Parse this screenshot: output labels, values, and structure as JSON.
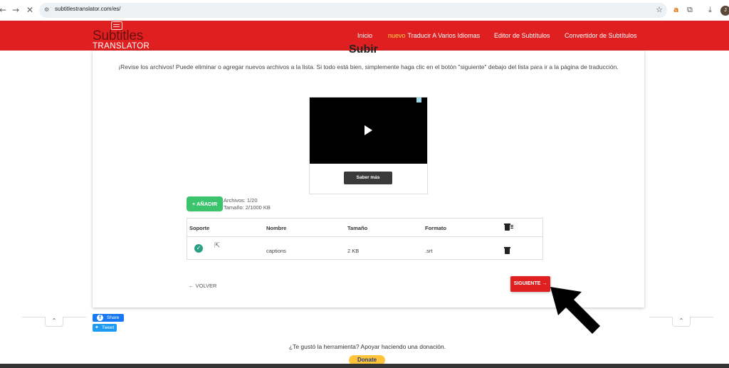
{
  "browser": {
    "url": "subtitlestranslator.com/es/",
    "profile_initial": "J"
  },
  "header": {
    "logo_main": "Subtitles",
    "logo_sub": "TRANSLATOR",
    "nav": [
      {
        "label": "Inicio"
      },
      {
        "badge": "nuevo",
        "label": "Traducir A Varios Idiomas"
      },
      {
        "label": "Editor de Subtítulos"
      },
      {
        "label": "Convertidor de Subtítulos"
      }
    ],
    "colors": {
      "brand": "#e02020",
      "new_badge": "#ffd54f"
    }
  },
  "main": {
    "title": "Subir",
    "intro": "¡Revise los archivos! Puede eliminar o agregar nuevos archivos a la lista. Si todo está bien, simplemente haga clic en el botón \"siguiente\" debajo del lista para ir a la página de traducción.",
    "ad": {
      "button_label": "Saber más"
    },
    "add_button": "+ AÑADIR",
    "files_count": "Archivos: 1/20",
    "size_info": "Tamaño: 2/1000 KB",
    "table": {
      "headers": [
        "Soporte",
        "Nombre",
        "Tamaño",
        "Formato"
      ],
      "rows": [
        {
          "name": "captions",
          "size": "2 KB",
          "format": ".srt"
        }
      ]
    },
    "back_button": "← VOLVER",
    "next_button": "SIGUIENTE →"
  },
  "social": {
    "share_label": "Share",
    "tweet_label": "Tweet"
  },
  "footer": {
    "donate_prompt": "¿Te gustó la herramienta? Apoyar haciendo una donación.",
    "donate_button": "Donate"
  }
}
